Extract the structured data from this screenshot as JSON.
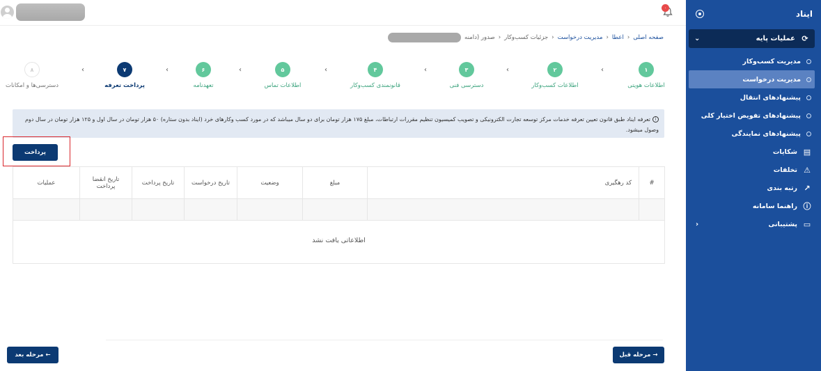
{
  "sidebar": {
    "title": "ایناد",
    "group_label": "عملیات پایه",
    "sub_items": [
      {
        "label": "مدیریت کسب‌وکار"
      },
      {
        "label": "مدیریت درخواست"
      },
      {
        "label": "پیشنهادهای انتقال"
      },
      {
        "label": "پیشنهادهای تفویض اختیار کلی"
      },
      {
        "label": "پیشنهادهای نمایندگی"
      }
    ],
    "main_items": [
      {
        "label": "شکایات",
        "icon": "document-icon"
      },
      {
        "label": "تخلفات",
        "icon": "warning-icon"
      },
      {
        "label": "رتبه بندی",
        "icon": "trend-icon"
      },
      {
        "label": "راهنما سامانه",
        "icon": "help-icon"
      },
      {
        "label": "پشتیبانی",
        "icon": "chat-icon"
      }
    ]
  },
  "topbar": {
    "notification_count": "۰"
  },
  "breadcrumb": {
    "items": [
      "صفحه اصلی",
      "اعطا",
      "مدیریت درخواست",
      "جزئیات کسب‌وکار",
      "صدور (دامنه"
    ]
  },
  "stepper": {
    "steps": [
      {
        "number": "۱",
        "label": "اطلاعات هویتی",
        "state": "done"
      },
      {
        "number": "۲",
        "label": "اطلاعات کسب‌وکار",
        "state": "done"
      },
      {
        "number": "۳",
        "label": "دسترسی فنی",
        "state": "done"
      },
      {
        "number": "۴",
        "label": "قانونمندی کسب‌وکار",
        "state": "done"
      },
      {
        "number": "۵",
        "label": "اطلاعات تماس",
        "state": "done"
      },
      {
        "number": "۶",
        "label": "تعهدنامه",
        "state": "done"
      },
      {
        "number": "۷",
        "label": "پرداخت تعرفه",
        "state": "current"
      },
      {
        "number": "۸",
        "label": "دسترسی‌ها و امکانات",
        "state": "pending"
      }
    ]
  },
  "info": {
    "text": "تعرفه ایناد طبق قانون تعیین تعرفه خدمات مرکز توسعه تجارت الکترونیکی و تصویب کمیسیون تنظیم مقررات ارتباطات، مبلغ ۱۷۵ هزار تومان برای دو سال میباشد که در مورد کسب وکارهای خرد (ایناد بدون ستاره) ۵۰ هزار تومان در سال اول و ۱۲۵ هزار تومان در سال دوم وصول میشود."
  },
  "pay_button": "پرداخت",
  "table": {
    "headers": [
      "#",
      "کد رهگیری",
      "مبلغ",
      "وضعیت",
      "تاریخ درخواست",
      "تاریخ پرداخت",
      "تاریخ انقضا پرداخت",
      "عملیات"
    ],
    "empty_text": "اطلاعاتی یافت نشد"
  },
  "footer": {
    "prev_label": "مرحله قبل →",
    "next_label": "مرحله بعد ←"
  },
  "colors": {
    "sidebar_bg": "#1b4f9c",
    "primary": "#0c3a73",
    "step_done": "#62c89c",
    "highlight": "#d9252b"
  }
}
